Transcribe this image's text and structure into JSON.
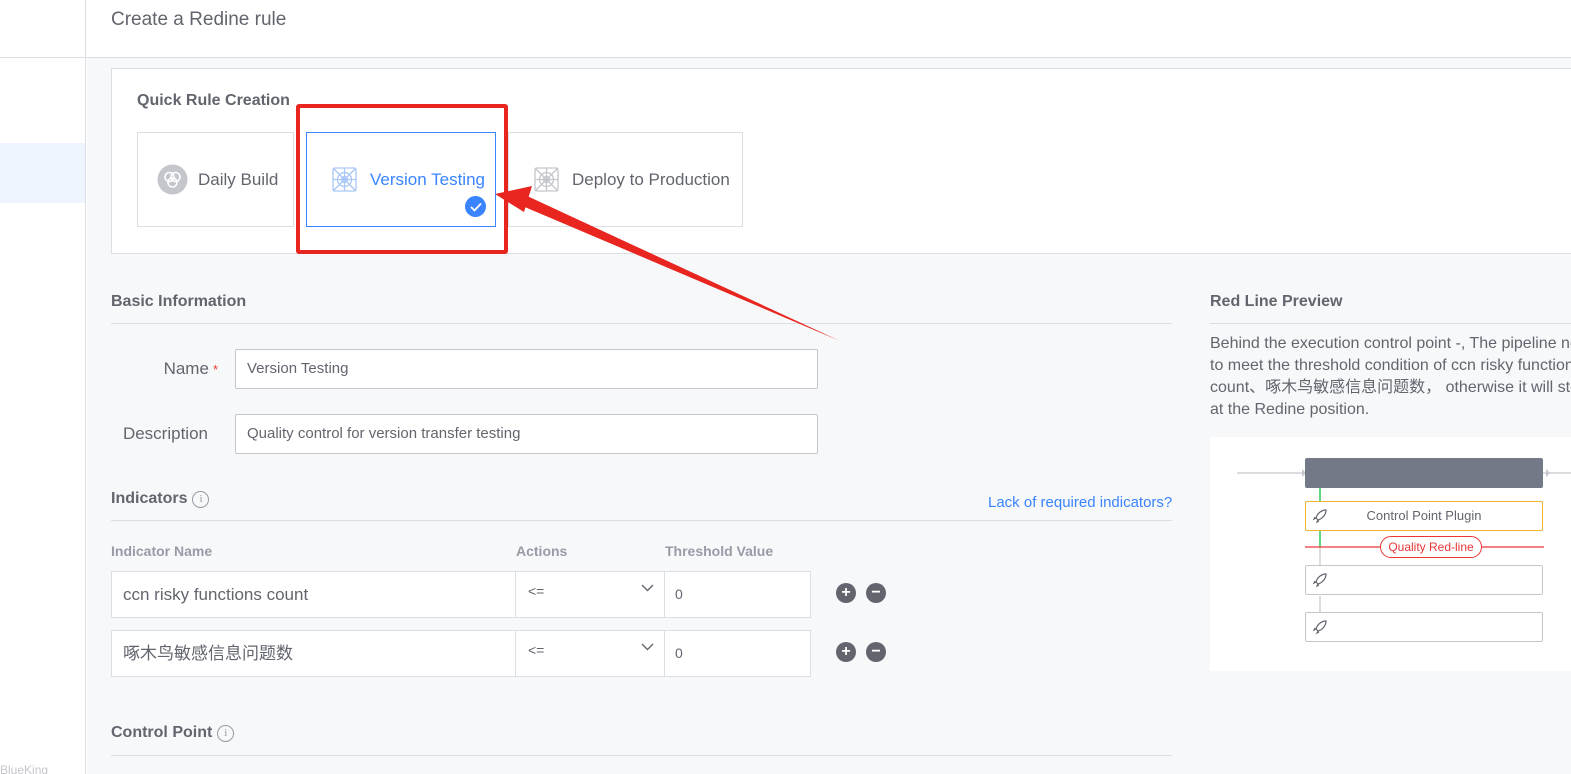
{
  "sidebar": {
    "footer": "BlueKing"
  },
  "header": {
    "title": "Create a Redine rule"
  },
  "quick": {
    "title": "Quick Rule Creation",
    "cards": [
      {
        "label": "Daily Build",
        "icon": "daily-build-icon"
      },
      {
        "label": "Version Testing",
        "icon": "version-testing-icon",
        "selected": true
      },
      {
        "label": "Deploy to Production",
        "icon": "deploy-icon"
      }
    ]
  },
  "basic": {
    "title": "Basic Information",
    "name_label": "Name",
    "required_mark": "*",
    "name_value": "Version Testing",
    "desc_label": "Description",
    "desc_value": "Quality control for version transfer testing"
  },
  "indicators": {
    "title": "Indicators",
    "info": "i",
    "missing_link": "Lack of required indicators?",
    "columns": [
      "Indicator Name",
      "Actions",
      "Threshold Value"
    ],
    "rows": [
      {
        "name": "ccn risky functions count",
        "action": "<=",
        "threshold": "0"
      },
      {
        "name": "啄木鸟敏感信息问题数",
        "action": "<=",
        "threshold": "0"
      }
    ],
    "add_symbol": "+",
    "remove_symbol": "−"
  },
  "control_point": {
    "title": "Control Point",
    "info": "i"
  },
  "preview": {
    "title": "Red Line Preview",
    "desc_lines": [
      "Behind the execution control point -, The pipeline needs",
      "to meet the threshold condition of ccn risky functions",
      "count、啄木鸟敏感信息问题数， otherwise it will stop",
      "at the Redine position."
    ],
    "plugin_label": "Control Point Plugin",
    "redline_label": "Quality Red-line"
  },
  "colors": {
    "accent": "#3a84ff",
    "annotation": "#e8251f",
    "redline": "#ea3636",
    "plugin_border": "#f0b72f",
    "stage": "#737987"
  }
}
